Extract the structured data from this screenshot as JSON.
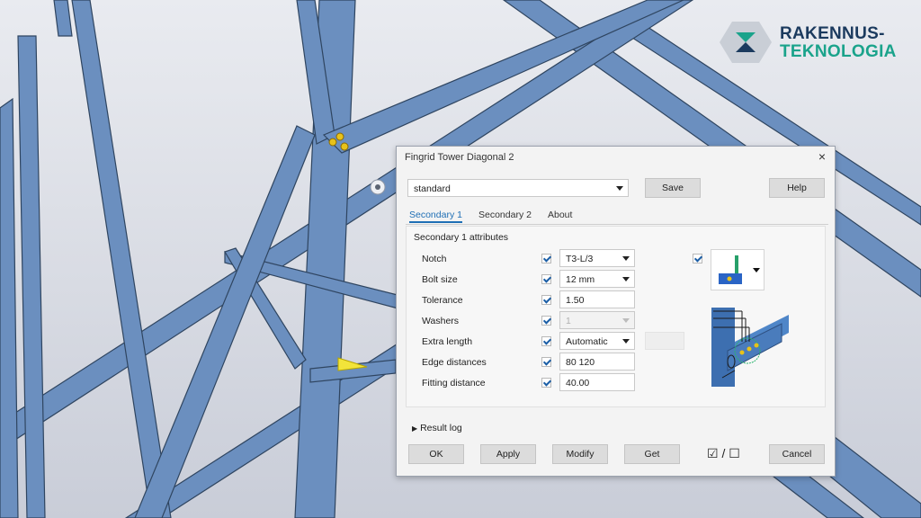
{
  "logo": {
    "line1": "RAKENNUS-",
    "line2": "TEKNOLOGIA"
  },
  "dialog": {
    "title": "Fingrid Tower Diagonal 2",
    "close_icon": "×",
    "preset": "standard",
    "save_label": "Save",
    "help_label": "Help",
    "tabs": [
      {
        "label": "Secondary 1",
        "active": true
      },
      {
        "label": "Secondary 2",
        "active": false
      },
      {
        "label": "About",
        "active": false
      }
    ],
    "section_title": "Secondary 1 attributes",
    "rows": [
      {
        "label": "Notch",
        "value": "T3-L/3",
        "type": "select"
      },
      {
        "label": "Bolt size",
        "value": "12 mm",
        "type": "select"
      },
      {
        "label": "Tolerance",
        "value": "1.50",
        "type": "text"
      },
      {
        "label": "Washers",
        "value": "1",
        "type": "select-disabled"
      },
      {
        "label": "Extra length",
        "value": "Automatic",
        "type": "select"
      },
      {
        "label": "Edge distances",
        "value": "80 120",
        "type": "text"
      },
      {
        "label": "Fitting distance",
        "value": "40.00",
        "type": "text"
      }
    ],
    "result_log": "Result log",
    "buttons": {
      "ok": "OK",
      "apply": "Apply",
      "modify": "Modify",
      "get": "Get",
      "cancel": "Cancel"
    },
    "toggle_text": "☑ / ☐"
  },
  "colors": {
    "steel": "#6b8fbf",
    "steel_dark": "#3d5778",
    "accent": "#1f6fb5",
    "bolt": "#e8c21a"
  }
}
